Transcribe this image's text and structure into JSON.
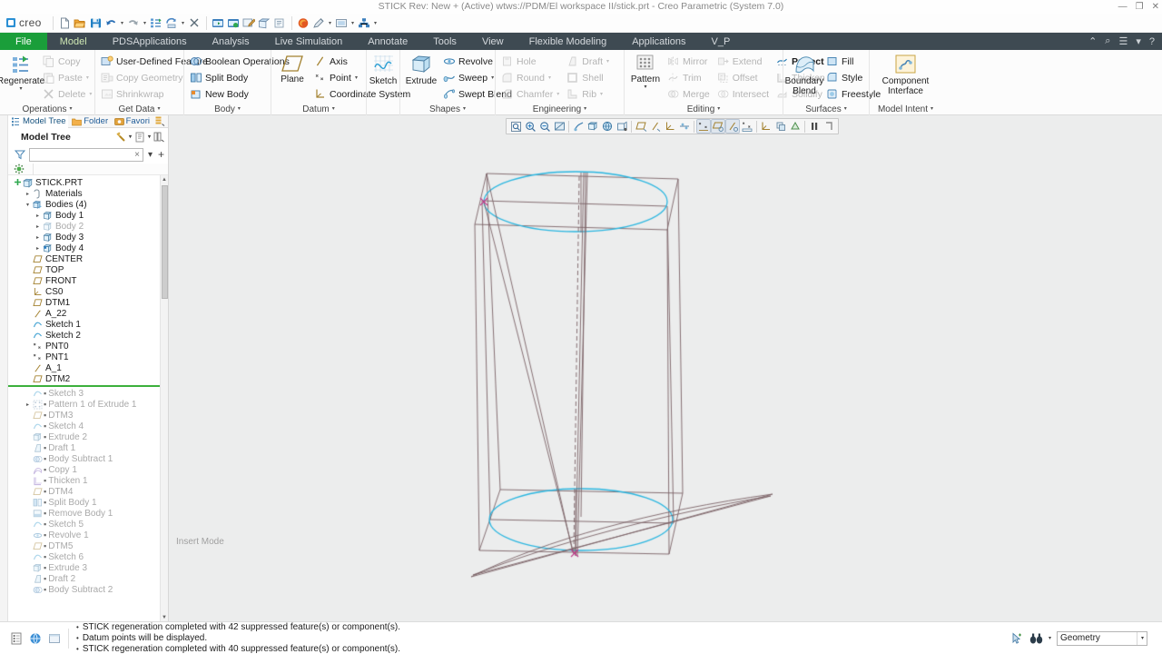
{
  "window": {
    "title": "STICK Rev: New + (Active) wtws://PDM/El workspace II/stick.prt - Creo Parametric (System 7.0)",
    "minimize": "—",
    "maximize": "❐",
    "close": "✕"
  },
  "quick_access": {
    "brand": "creo",
    "brand_mark": "·",
    "items": [
      {
        "name": "new-file-icon",
        "label": "New"
      },
      {
        "name": "open-file-icon",
        "label": "Open"
      },
      {
        "name": "save-icon",
        "label": "Save"
      },
      {
        "name": "undo-icon",
        "label": "Undo"
      },
      {
        "name": "redo-icon",
        "label": "Redo"
      },
      {
        "name": "regenerate-icon",
        "label": "Regenerate"
      },
      {
        "name": "repaint-icon",
        "label": "Repaint"
      },
      {
        "name": "close-window-icon",
        "label": "Close Window"
      },
      {
        "name": "window-switch-icon",
        "label": "Switch Window"
      },
      {
        "name": "window-activate-icon",
        "label": "Activate Window"
      },
      {
        "name": "annotate-icon",
        "label": "Annotate"
      },
      {
        "name": "sketch-tool-icon",
        "label": "Sketch"
      },
      {
        "name": "note-icon",
        "label": "Note"
      },
      {
        "name": "firefox-icon",
        "label": "Browser"
      },
      {
        "name": "appearance-icon",
        "label": "Appearance"
      },
      {
        "name": "view-manager-icon",
        "label": "View Manager"
      },
      {
        "name": "tree-icon",
        "label": "Tree Tools"
      }
    ]
  },
  "ribbon": {
    "tabs": [
      {
        "label": "File",
        "kind": "file"
      },
      {
        "label": "Model",
        "kind": "active"
      },
      {
        "label": "PDSApplications",
        "kind": "normal"
      },
      {
        "label": "Analysis",
        "kind": "normal"
      },
      {
        "label": "Live Simulation",
        "kind": "normal"
      },
      {
        "label": "Annotate",
        "kind": "normal"
      },
      {
        "label": "Tools",
        "kind": "normal"
      },
      {
        "label": "View",
        "kind": "normal"
      },
      {
        "label": "Flexible Modeling",
        "kind": "normal"
      },
      {
        "label": "Applications",
        "kind": "normal"
      },
      {
        "label": "V_P",
        "kind": "normal"
      }
    ],
    "right_controls": [
      {
        "name": "collapse-ribbon-icon",
        "glyph": "⌃"
      },
      {
        "name": "search-icon",
        "glyph": "⌕"
      },
      {
        "name": "account-icon",
        "glyph": "☰"
      },
      {
        "name": "account-dropdown-icon",
        "glyph": "▾"
      },
      {
        "name": "help-icon",
        "glyph": "?"
      }
    ],
    "groups": [
      {
        "title": "Operations",
        "has_dropdown": true,
        "big": {
          "label": "Regenerate",
          "disabled": false,
          "has_dropdown": true,
          "icon": "regenerate-icon"
        },
        "items": [
          {
            "label": "Copy",
            "icon": "copy-icon",
            "disabled": true,
            "dropdown": false
          },
          {
            "label": "Paste",
            "icon": "paste-icon",
            "disabled": true,
            "dropdown": true
          },
          {
            "label": "Delete",
            "icon": "delete-icon",
            "disabled": true,
            "dropdown": true
          }
        ]
      },
      {
        "title": "Get Data",
        "has_dropdown": true,
        "items": [
          {
            "label": "User-Defined Feature",
            "icon": "udf-icon",
            "disabled": false,
            "dropdown": false
          },
          {
            "label": "Copy Geometry",
            "icon": "copy-geometry-icon",
            "disabled": true,
            "dropdown": false
          },
          {
            "label": "Shrinkwrap",
            "icon": "shrinkwrap-icon",
            "disabled": true,
            "dropdown": false
          }
        ]
      },
      {
        "title": "Body",
        "has_dropdown": true,
        "items": [
          {
            "label": "Boolean Operations",
            "icon": "boolean-operations-icon",
            "disabled": false,
            "dropdown": false
          },
          {
            "label": "Split Body",
            "icon": "split-body-icon",
            "disabled": false,
            "dropdown": false
          },
          {
            "label": "New Body",
            "icon": "new-body-icon",
            "disabled": false,
            "dropdown": false
          }
        ]
      },
      {
        "title": "Datum",
        "has_dropdown": true,
        "big": {
          "label": "Plane",
          "disabled": false,
          "has_dropdown": false,
          "icon": "datum-plane-icon"
        },
        "items": [
          {
            "label": "Axis",
            "icon": "datum-axis-icon",
            "disabled": false,
            "dropdown": false
          },
          {
            "label": "Point",
            "icon": "datum-point-icon",
            "disabled": false,
            "dropdown": true
          },
          {
            "label": "Coordinate System",
            "icon": "coordinate-system-icon",
            "disabled": false,
            "dropdown": false
          }
        ]
      },
      {
        "title": "",
        "has_dropdown": false,
        "big": {
          "label": "Sketch",
          "disabled": false,
          "has_dropdown": false,
          "icon": "sketch-icon"
        },
        "items": []
      },
      {
        "title": "Shapes",
        "has_dropdown": true,
        "big": {
          "label": "Extrude",
          "disabled": false,
          "has_dropdown": false,
          "icon": "extrude-icon"
        },
        "items": [
          {
            "label": "Revolve",
            "icon": "revolve-icon",
            "disabled": false,
            "dropdown": false
          },
          {
            "label": "Sweep",
            "icon": "sweep-icon",
            "disabled": false,
            "dropdown": true
          },
          {
            "label": "Swept Blend",
            "icon": "swept-blend-icon",
            "disabled": false,
            "dropdown": false
          }
        ]
      },
      {
        "title": "Engineering",
        "has_dropdown": true,
        "items": [
          {
            "label": "Hole",
            "icon": "hole-icon",
            "disabled": true,
            "dropdown": false
          },
          {
            "label": "Round",
            "icon": "round-icon",
            "disabled": true,
            "dropdown": true
          },
          {
            "label": "Chamfer",
            "icon": "chamfer-icon",
            "disabled": true,
            "dropdown": true
          }
        ],
        "items2": [
          {
            "label": "Draft",
            "icon": "draft-icon",
            "disabled": true,
            "dropdown": true
          },
          {
            "label": "Shell",
            "icon": "shell-icon",
            "disabled": true,
            "dropdown": false
          },
          {
            "label": "Rib",
            "icon": "rib-icon",
            "disabled": true,
            "dropdown": true
          }
        ]
      },
      {
        "title": "Editing",
        "has_dropdown": true,
        "big": {
          "label": "Pattern",
          "disabled": false,
          "has_dropdown": true,
          "icon": "pattern-icon"
        },
        "items": [
          {
            "label": "Mirror",
            "icon": "mirror-icon",
            "disabled": true,
            "dropdown": false
          },
          {
            "label": "Trim",
            "icon": "trim-icon",
            "disabled": true,
            "dropdown": false
          },
          {
            "label": "Merge",
            "icon": "merge-icon",
            "disabled": true,
            "dropdown": false
          }
        ],
        "items2": [
          {
            "label": "Extend",
            "icon": "extend-icon",
            "disabled": true,
            "dropdown": false
          },
          {
            "label": "Offset",
            "icon": "offset-icon",
            "disabled": true,
            "dropdown": false
          },
          {
            "label": "Intersect",
            "icon": "intersect-icon",
            "disabled": true,
            "dropdown": false
          }
        ],
        "items3": [
          {
            "label": "Project",
            "icon": "project-icon",
            "disabled": false,
            "dropdown": false
          },
          {
            "label": "Thicken",
            "icon": "thicken-icon",
            "disabled": true,
            "dropdown": false
          },
          {
            "label": "Solidify",
            "icon": "solidify-icon",
            "disabled": true,
            "dropdown": false
          }
        ]
      },
      {
        "title": "Surfaces",
        "has_dropdown": true,
        "big": {
          "label": "Boundary\nBlend",
          "disabled": false,
          "has_dropdown": false,
          "icon": "boundary-blend-icon"
        },
        "items": [
          {
            "label": "Fill",
            "icon": "fill-icon",
            "disabled": false,
            "dropdown": false
          },
          {
            "label": "Style",
            "icon": "style-icon",
            "disabled": false,
            "dropdown": false
          },
          {
            "label": "Freestyle",
            "icon": "freestyle-icon",
            "disabled": false,
            "dropdown": false
          }
        ]
      },
      {
        "title": "Model Intent",
        "has_dropdown": true,
        "big": {
          "label": "Component\nInterface",
          "disabled": false,
          "has_dropdown": false,
          "icon": "component-interface-icon"
        },
        "items": []
      }
    ]
  },
  "model_tree": {
    "tabs": [
      {
        "label": "Model Tree",
        "icon": "model-tree-icon",
        "selected": true
      },
      {
        "label": "Folder",
        "icon": "folder-icon",
        "selected": false
      },
      {
        "label": "Favori",
        "icon": "favorites-icon",
        "selected": false
      },
      {
        "label": "",
        "icon": "layers-icon",
        "selected": false
      }
    ],
    "header": "Model Tree",
    "header_icons": [
      {
        "name": "tree-filters-icon",
        "dropdown": true
      },
      {
        "name": "tree-display-icon",
        "dropdown": true
      },
      {
        "name": "tree-columns-icon",
        "dropdown": false
      }
    ],
    "filter": {
      "value": "",
      "placeholder": "",
      "clear": "×",
      "dropdown": "▾",
      "add": "+"
    },
    "items": [
      {
        "label": "STICK.PRT",
        "indent": 0,
        "icon": "part-icon",
        "expander": "plus",
        "suppressed": false
      },
      {
        "label": "Materials",
        "indent": 1,
        "icon": "materials-icon",
        "expander": "collapsed",
        "suppressed": false
      },
      {
        "label": "Bodies (4)",
        "indent": 1,
        "icon": "bodies-icon",
        "expander": "expanded",
        "suppressed": false
      },
      {
        "label": "Body 1",
        "indent": 2,
        "icon": "body-icon",
        "expander": "collapsed",
        "suppressed": false
      },
      {
        "label": "Body 2",
        "indent": 2,
        "icon": "body-icon",
        "expander": "collapsed",
        "suppressed": true
      },
      {
        "label": "Body 3",
        "indent": 2,
        "icon": "body-icon",
        "expander": "collapsed",
        "suppressed": false
      },
      {
        "label": "Body 4",
        "indent": 2,
        "icon": "body-active-icon",
        "expander": "collapsed",
        "suppressed": false
      },
      {
        "label": "CENTER",
        "indent": 1,
        "icon": "datum-plane-icon",
        "expander": "none",
        "suppressed": false
      },
      {
        "label": "TOP",
        "indent": 1,
        "icon": "datum-plane-icon",
        "expander": "none",
        "suppressed": false
      },
      {
        "label": "FRONT",
        "indent": 1,
        "icon": "datum-plane-icon",
        "expander": "none",
        "suppressed": false
      },
      {
        "label": "CS0",
        "indent": 1,
        "icon": "coordinate-system-icon",
        "expander": "none",
        "suppressed": false
      },
      {
        "label": "DTM1",
        "indent": 1,
        "icon": "datum-plane-icon",
        "expander": "none",
        "suppressed": false
      },
      {
        "label": "A_22",
        "indent": 1,
        "icon": "datum-axis-icon",
        "expander": "none",
        "suppressed": false
      },
      {
        "label": "Sketch 1",
        "indent": 1,
        "icon": "sketch-icon",
        "expander": "none",
        "suppressed": false
      },
      {
        "label": "Sketch 2",
        "indent": 1,
        "icon": "sketch-icon",
        "expander": "none",
        "suppressed": false
      },
      {
        "label": "PNT0",
        "indent": 1,
        "icon": "datum-point-icon",
        "expander": "none",
        "suppressed": false
      },
      {
        "label": "PNT1",
        "indent": 1,
        "icon": "datum-point-icon",
        "expander": "none",
        "suppressed": false
      },
      {
        "label": "A_1",
        "indent": 1,
        "icon": "datum-axis-icon",
        "expander": "none",
        "suppressed": false
      },
      {
        "label": "DTM2",
        "indent": 1,
        "icon": "datum-plane-icon",
        "expander": "none",
        "suppressed": false
      }
    ],
    "insert_divider": true,
    "suppressed_items": [
      {
        "label": "Sketch 3",
        "indent": 1,
        "icon": "sketch-icon",
        "expander": "none"
      },
      {
        "label": "Pattern 1 of Extrude 1",
        "indent": 1,
        "icon": "pattern-icon",
        "expander": "collapsed"
      },
      {
        "label": "DTM3",
        "indent": 1,
        "icon": "datum-plane-icon",
        "expander": "none"
      },
      {
        "label": "Sketch 4",
        "indent": 1,
        "icon": "sketch-icon",
        "expander": "none"
      },
      {
        "label": "Extrude 2",
        "indent": 1,
        "icon": "extrude-icon",
        "expander": "none"
      },
      {
        "label": "Draft 1",
        "indent": 1,
        "icon": "draft-icon",
        "expander": "none"
      },
      {
        "label": "Body Subtract 1",
        "indent": 1,
        "icon": "boolean-operations-icon",
        "expander": "none"
      },
      {
        "label": "Copy 1",
        "indent": 1,
        "icon": "copy-surface-icon",
        "expander": "none"
      },
      {
        "label": "Thicken 1",
        "indent": 1,
        "icon": "thicken-icon",
        "expander": "none"
      },
      {
        "label": "DTM4",
        "indent": 1,
        "icon": "datum-plane-icon",
        "expander": "none"
      },
      {
        "label": "Split Body 1",
        "indent": 1,
        "icon": "split-body-icon",
        "expander": "none"
      },
      {
        "label": "Remove Body 1",
        "indent": 1,
        "icon": "remove-body-icon",
        "expander": "none"
      },
      {
        "label": "Sketch 5",
        "indent": 1,
        "icon": "sketch-icon",
        "expander": "none"
      },
      {
        "label": "Revolve 1",
        "indent": 1,
        "icon": "revolve-icon",
        "expander": "none"
      },
      {
        "label": "DTM5",
        "indent": 1,
        "icon": "datum-plane-icon",
        "expander": "none"
      },
      {
        "label": "Sketch 6",
        "indent": 1,
        "icon": "sketch-icon",
        "expander": "none"
      },
      {
        "label": "Extrude 3",
        "indent": 1,
        "icon": "extrude-icon",
        "expander": "none"
      },
      {
        "label": "Draft 2",
        "indent": 1,
        "icon": "draft-icon",
        "expander": "none"
      },
      {
        "label": "Body Subtract 2",
        "indent": 1,
        "icon": "boolean-operations-icon",
        "expander": "none"
      }
    ]
  },
  "viewport": {
    "insert_mode_label": "Insert Mode",
    "background": "#eceded",
    "graphics_toolbar": [
      {
        "name": "zoom-fit-icon",
        "active": false
      },
      {
        "name": "zoom-in-icon",
        "active": false
      },
      {
        "name": "zoom-out-icon",
        "active": false
      },
      {
        "name": "repaint-icon",
        "active": false
      },
      {
        "name": "spin-center-icon",
        "active": false
      },
      {
        "name": "saved-orientations-icon",
        "active": false
      },
      {
        "name": "view-manager-icon",
        "active": false
      },
      {
        "name": "perspective-icon",
        "active": false
      },
      {
        "name": "datum-display-plane-icon",
        "active": false
      },
      {
        "name": "datum-display-axis-icon",
        "active": false
      },
      {
        "name": "datum-display-csys-icon",
        "active": false
      },
      {
        "name": "annotation-display-icon",
        "active": false
      },
      {
        "name": "datum-plane-toggle-icon",
        "active": true
      },
      {
        "name": "datum-axis-toggle-icon",
        "active": true
      },
      {
        "name": "datum-point-toggle-icon",
        "active": true
      },
      {
        "name": "csys-toggle-icon",
        "active": false
      },
      {
        "name": "display-style-icon",
        "active": false
      },
      {
        "name": "appearance-gallery-icon",
        "active": false
      },
      {
        "name": "layer-display-icon",
        "active": false
      },
      {
        "name": "pause-icon",
        "active": false
      },
      {
        "name": "stop-icon",
        "active": false
      }
    ],
    "colors": {
      "edge": "#7a6165",
      "highlight": "#2ab6e0",
      "datum_point": "#c0398a"
    }
  },
  "status_bar": {
    "left_icons": [
      {
        "name": "selection-filter-icon"
      },
      {
        "name": "web-link-icon"
      },
      {
        "name": "browser-toggle-icon"
      }
    ],
    "messages": [
      "STICK regeneration completed with 42 suppressed feature(s) or component(s).",
      "Datum points will be displayed.",
      "STICK regeneration completed with 40 suppressed feature(s) or component(s)."
    ],
    "right_icons": [
      {
        "name": "selection-tool-icon"
      },
      {
        "name": "find-icon"
      },
      {
        "name": "find-dropdown-icon"
      }
    ],
    "selection_filter": {
      "value": "Geometry",
      "arrow": "▾"
    }
  }
}
